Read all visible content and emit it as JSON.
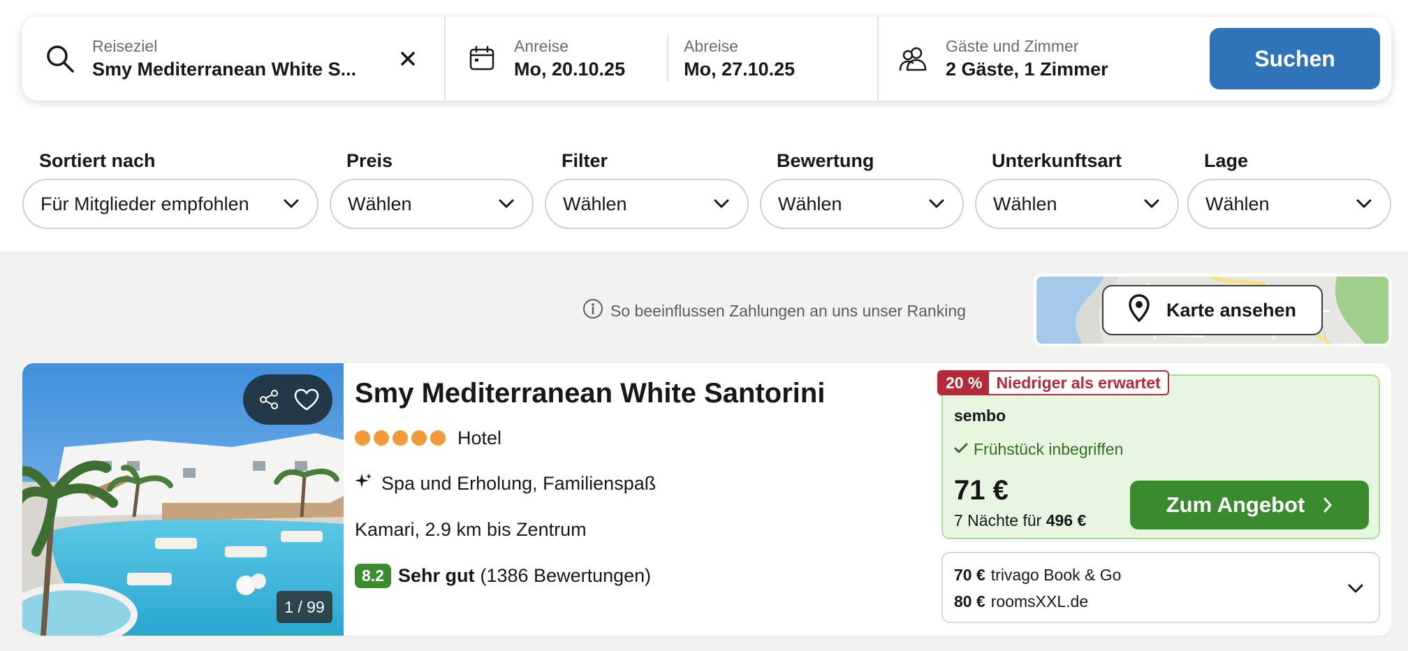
{
  "search": {
    "destination_label": "Reiseziel",
    "destination_value": "Smy Mediterranean White S...",
    "checkin_label": "Anreise",
    "checkin_value": "Mo, 20.10.25",
    "checkout_label": "Abreise",
    "checkout_value": "Mo, 27.10.25",
    "guests_label": "Gäste und Zimmer",
    "guests_value": "2 Gäste, 1 Zimmer",
    "search_button": "Suchen",
    "icons": [
      "search-icon",
      "close-icon",
      "calendar-icon",
      "guests-icon"
    ]
  },
  "filters": [
    {
      "label": "Sortiert nach",
      "value": "Für Mitglieder empfohlen"
    },
    {
      "label": "Preis",
      "value": "Wählen"
    },
    {
      "label": "Filter",
      "value": "Wählen"
    },
    {
      "label": "Bewertung",
      "value": "Wählen"
    },
    {
      "label": "Unterkunftsart",
      "value": "Wählen"
    },
    {
      "label": "Lage",
      "value": "Wählen"
    }
  ],
  "ranking_info": "So beeinflussen Zahlungen an uns unser Ranking",
  "map_button": "Karte ansehen",
  "hotel": {
    "name": "Smy Mediterranean White Santorini",
    "stars": 5,
    "type": "Hotel",
    "amenities": "Spa und Erholung, Familienspaß",
    "location": "Kamari, 2.9 km bis Zentrum",
    "rating_score": "8.2",
    "rating_label": "Sehr gut",
    "rating_count": "(1386 Bewertungen)",
    "photo_counter": "1 / 99",
    "deal": {
      "badge_percent": "20 %",
      "badge_text": "Niedriger als erwartet",
      "provider": "sembo",
      "breakfast": "Frühstück inbegriffen",
      "price": "71 €",
      "nights_prefix": "7 Nächte für",
      "nights_total": "496 €",
      "button": "Zum Angebot"
    },
    "other_offers": [
      {
        "price": "70 €",
        "provider": "trivago Book & Go"
      },
      {
        "price": "80 €",
        "provider": "roomsXXL.de"
      }
    ]
  },
  "colors": {
    "primary_blue": "#2f73b8",
    "deal_green": "#3a8a2e",
    "deal_bg": "#e6f6e1",
    "badge_red": "#b52a3a",
    "star_orange": "#f29a3a"
  }
}
